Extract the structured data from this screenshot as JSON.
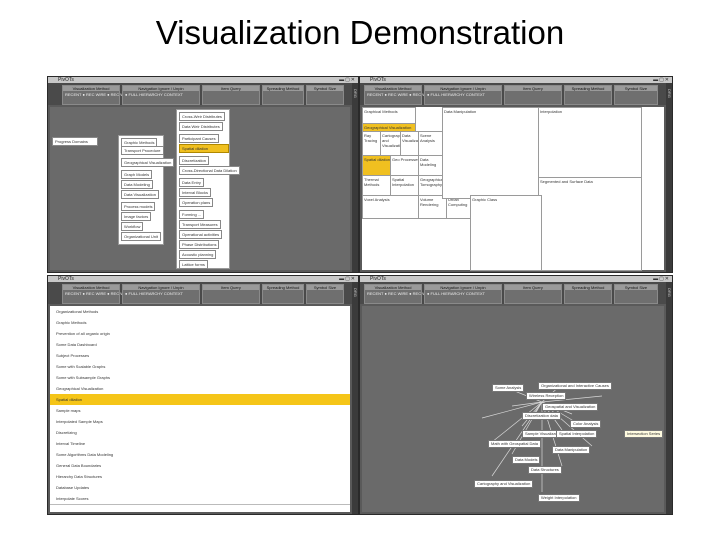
{
  "slide": {
    "title": "Visualization Demonstration"
  },
  "app": {
    "window_title": "PivOTs"
  },
  "toolbar": {
    "groups": [
      {
        "label": "Visualization Method",
        "sub": "RECENT  ● REC WIRE  ● REC WVE"
      },
      {
        "label": "Navigation Ignore / Unpin",
        "sub": "● FULL HIERARCHY CONTEXT"
      },
      {
        "label": "Item Query",
        "sub": ""
      },
      {
        "label": "Spreading Method",
        "sub": ""
      },
      {
        "label": "Symbol Size",
        "sub": ""
      }
    ],
    "sidebar_text": "DRG"
  },
  "panels": {
    "p1": {
      "root": "Progress Domains",
      "col1": [
        "Graphic Methods",
        "Transport Procedure",
        "Geographical Visualization",
        "Graph Models",
        "Data Modeling",
        "Data Visualization",
        "Process models",
        "Image factors",
        "Workflow",
        "Organizational Unit"
      ],
      "col2": [
        "Cross-Weir Distributes",
        "Data Weir Distributes",
        "Participant Causes",
        "Spatial Dilation",
        "Discretization",
        "Cross-Directional Data Dilation",
        "Data Entry",
        "Interval Blocks",
        "Operation plans",
        "Forming ...",
        "Transport Measures",
        "Operational activities",
        "Phase Distributions",
        "Acoustic planning",
        "Lattice forms",
        "Boundary Blocks"
      ],
      "selected": "Spatial dilation"
    },
    "p2": {
      "cells": [
        "Graphical Methods",
        "Geographical Visualization",
        "Ray Tracing",
        "Cartography and Visualization",
        "Data Visualization",
        "Scene Analysis",
        "Spatial dilation",
        "Geo Processes",
        "Data Modeling",
        "Thermal Methods",
        "Spatial Interpolation",
        "Geographical Tomography",
        "Voxel Analysis",
        "Volume Rendering",
        "Urban Computing",
        "Data Manipulation",
        "Interpolation",
        "Segmented and Surface Data",
        "Graphic Class"
      ]
    },
    "p3": {
      "rows": [
        "Organizational Methods",
        "Graphic Methods",
        "Prevention of all organic origin",
        "Some Data Dashboard",
        "Subject Processes",
        "Some with Scalable Graphs",
        "Some with Subsample Graphs",
        "Geographical Visualization",
        "Spatial dilation",
        "Sample maps",
        "Interpolated Sample Maps",
        "Discretizing",
        "Interval Timeline",
        "Some Algorithms Data Modeling",
        "General Data Boundaries",
        "Hierarchy Data Structures",
        "Database Updates",
        "Interpolate Scores"
      ],
      "selected": "Spatial dilation"
    },
    "p4": {
      "nodes": [
        "Some Analysis",
        "Organizational and Interactive Causes",
        "Wireless Reception",
        "Geospatial and Visualization",
        "Discretization data",
        "Color Analysis",
        "Sample Visualizations",
        "Spatial Interpolation",
        "Intersection Series",
        "Math with Geospatial Data",
        "Data Manipulation",
        "Data Models",
        "Data Structures",
        "Cartography and Visualization",
        "Weight Interpolation"
      ]
    }
  }
}
